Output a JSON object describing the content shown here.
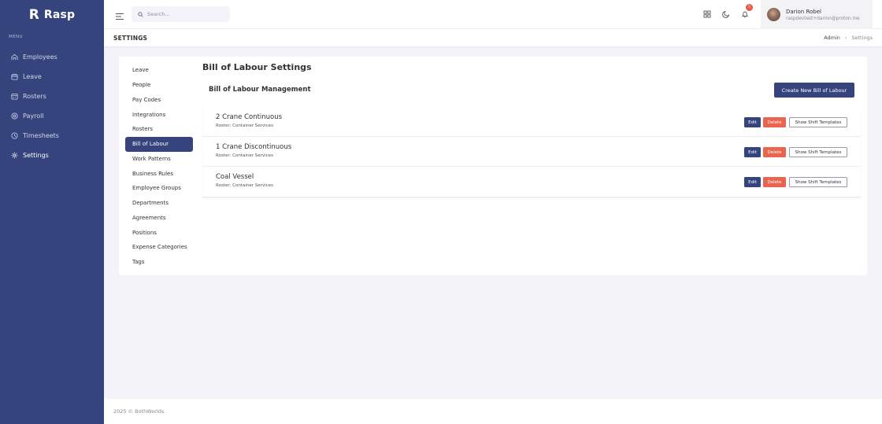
{
  "brand": {
    "name": "Rasp",
    "logo_mark": "R"
  },
  "sidebar": {
    "menu_title": "MENU",
    "items": [
      {
        "label": "Employees",
        "icon": "employees-icon"
      },
      {
        "label": "Leave",
        "icon": "leave-icon"
      },
      {
        "label": "Rosters",
        "icon": "rosters-icon"
      },
      {
        "label": "Payroll",
        "icon": "payroll-icon"
      },
      {
        "label": "Timesheets",
        "icon": "timesheets-icon"
      },
      {
        "label": "Settings",
        "icon": "settings-icon",
        "active": true
      }
    ]
  },
  "topbar": {
    "search_placeholder": "Search...",
    "notification_count": "5",
    "user": {
      "name": "Darion Robel",
      "email": "raspdevtest+darion@proton.me"
    }
  },
  "page": {
    "title": "SETTINGS",
    "breadcrumb": {
      "parent": "Admin",
      "current": "Settings"
    }
  },
  "settings_menu": {
    "items": [
      "Leave",
      "People",
      "Pay Codes",
      "Integrations",
      "Rosters",
      "Bill of Labour",
      "Work Patterns",
      "Business Rules",
      "Employee Groups",
      "Departments",
      "Agreements",
      "Positions",
      "Expense Categories",
      "Tags"
    ],
    "active": "Bill of Labour"
  },
  "content": {
    "title": "Bill of Labour Settings",
    "management_title": "Bill of Labour Management",
    "create_button": "Create New Bill of Labour",
    "rows": [
      {
        "name": "2 Crane Continuous",
        "roster": "Roster: Container Services"
      },
      {
        "name": "1 Crane Discontinuous",
        "roster": "Roster: Container Services"
      },
      {
        "name": "Coal Vessel",
        "roster": "Roster: Container Services"
      }
    ],
    "row_actions": {
      "edit": "Edit",
      "delete": "Delete",
      "templates": "Show Shift Templates"
    }
  },
  "footer": {
    "text": "2025 © BothWorlds."
  },
  "colors": {
    "primary": "#35447c",
    "danger": "#e9654f",
    "background": "#f3f3f9"
  }
}
